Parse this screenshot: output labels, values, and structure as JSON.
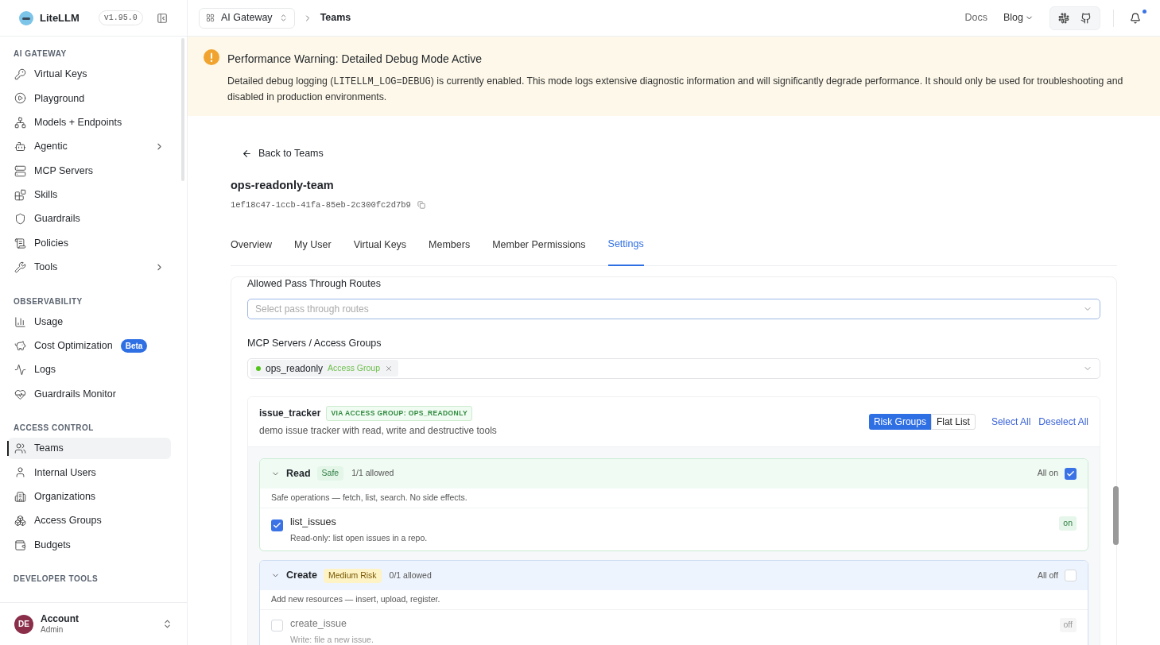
{
  "sidebar": {
    "logo": "LiteLLM",
    "version": "v1.95.0",
    "sections": [
      {
        "title": "AI GATEWAY",
        "items": [
          {
            "label": "Virtual Keys",
            "selected": false,
            "expandable": false
          },
          {
            "label": "Playground",
            "selected": false,
            "expandable": false
          },
          {
            "label": "Models + Endpoints",
            "selected": false,
            "expandable": false
          },
          {
            "label": "Agentic",
            "selected": false,
            "expandable": true
          },
          {
            "label": "MCP Servers",
            "selected": false,
            "expandable": false
          },
          {
            "label": "Skills",
            "selected": false,
            "expandable": false
          },
          {
            "label": "Guardrails",
            "selected": false,
            "expandable": false
          },
          {
            "label": "Policies",
            "selected": false,
            "expandable": false
          },
          {
            "label": "Tools",
            "selected": false,
            "expandable": true
          }
        ]
      },
      {
        "title": "OBSERVABILITY",
        "items": [
          {
            "label": "Usage",
            "selected": false,
            "expandable": false
          },
          {
            "label": "Cost Optimization",
            "selected": false,
            "expandable": false,
            "badge": "Beta"
          },
          {
            "label": "Logs",
            "selected": false,
            "expandable": false
          },
          {
            "label": "Guardrails Monitor",
            "selected": false,
            "expandable": false
          }
        ]
      },
      {
        "title": "ACCESS CONTROL",
        "items": [
          {
            "label": "Teams",
            "selected": true,
            "expandable": false
          },
          {
            "label": "Internal Users",
            "selected": false,
            "expandable": false
          },
          {
            "label": "Organizations",
            "selected": false,
            "expandable": false
          },
          {
            "label": "Access Groups",
            "selected": false,
            "expandable": false
          },
          {
            "label": "Budgets",
            "selected": false,
            "expandable": false
          }
        ]
      },
      {
        "title": "DEVELOPER TOOLS"
      }
    ],
    "account": {
      "initials": "DE",
      "name": "Account",
      "role": "Admin"
    }
  },
  "topbar": {
    "workspace": "AI Gateway",
    "breadcrumb": "Teams",
    "links": [
      {
        "label": "Docs",
        "dropdown": false
      },
      {
        "label": "Blog",
        "dropdown": true
      }
    ],
    "notification_dot": true
  },
  "banner": {
    "title": "Performance Warning: Detailed Debug Mode Active",
    "body_before": "Detailed debug logging (",
    "code": "LITELLM_LOG=DEBUG",
    "body_after": ") is currently enabled. This mode logs extensive diagnostic information and will significantly degrade performance. It should only be used for troubleshooting and disabled in production environments."
  },
  "back_link": "Back to Teams",
  "team": {
    "name": "ops-readonly-team",
    "id": "1ef18c47-1ccb-41fa-85eb-2c300fc2d7b9"
  },
  "tabs": [
    {
      "label": "Overview",
      "selected": false
    },
    {
      "label": "My User",
      "selected": false
    },
    {
      "label": "Virtual Keys",
      "selected": false
    },
    {
      "label": "Members",
      "selected": false
    },
    {
      "label": "Member Permissions",
      "selected": false
    },
    {
      "label": "Settings",
      "selected": true
    }
  ],
  "settings": {
    "pass_through": {
      "label": "Allowed Pass Through Routes",
      "placeholder": "Select pass through routes"
    },
    "mcp": {
      "label": "MCP Servers / Access Groups",
      "tags": [
        {
          "name": "ops_readonly",
          "type": "Access Group",
          "color": "#52c41a"
        }
      ]
    },
    "server": {
      "name": "issue_tracker",
      "via": "VIA ACCESS GROUP: OPS_READONLY",
      "description": "demo issue tracker with read, write and destructive tools",
      "views": [
        {
          "label": "Risk Groups",
          "selected": true
        },
        {
          "label": "Flat List",
          "selected": false
        }
      ],
      "actions": [
        "Select All",
        "Deselect All"
      ],
      "groups": [
        {
          "kind": "safe",
          "name": "Read",
          "risk": "Safe",
          "count": "1/1 allowed",
          "all_label": "All on",
          "all_checked": true,
          "description": "Safe operations — fetch, list, search. No side effects.",
          "tools": [
            {
              "name": "list_issues",
              "description": "Read-only: list open issues in a repo.",
              "checked": true,
              "status": "on"
            }
          ]
        },
        {
          "kind": "medium",
          "name": "Create",
          "risk": "Medium Risk",
          "count": "0/1 allowed",
          "all_label": "All off",
          "all_checked": false,
          "description": "Add new resources — insert, upload, register.",
          "tools": [
            {
              "name": "create_issue",
              "description": "Write: file a new issue.",
              "checked": false,
              "status": "off"
            }
          ]
        }
      ]
    }
  }
}
